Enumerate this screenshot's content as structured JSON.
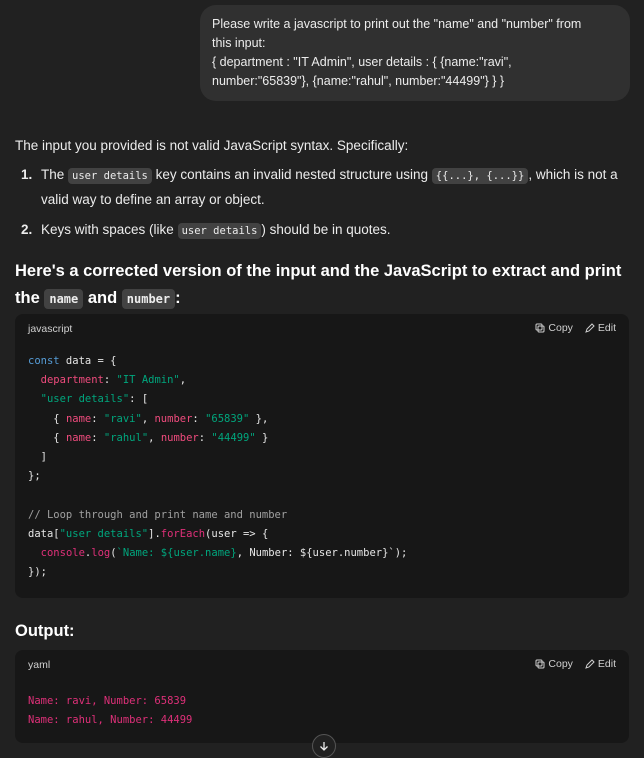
{
  "user_message": {
    "line1": "Please write a javascript to print out the \"name\" and \"number\" from",
    "line2": "this input:",
    "line3": "{ department : \"IT Admin\", user details : { {name:\"ravi\",",
    "line4": "number:\"65839\"}, {name:\"rahul\", number:\"44499\"} } }"
  },
  "response": {
    "intro": "The input you provided is not valid JavaScript syntax. Specifically:",
    "list": [
      {
        "num": "1.",
        "before": "The ",
        "code1": "user details",
        "middle": " key contains an invalid nested structure using ",
        "code2": "{{...}, {...}}",
        "after": ", which is not a valid way to define an array or object."
      },
      {
        "num": "2.",
        "before": "Keys with spaces (like ",
        "code1": "user details",
        "after": ") should be in quotes."
      }
    ],
    "heading": {
      "before": "Here's a corrected version of the input and the JavaScript to extract and print the ",
      "code1": "name",
      "middle": " and ",
      "code2": "number",
      "after": ":"
    },
    "code_block_1": {
      "lang": "javascript",
      "copy_label": "Copy",
      "edit_label": "Edit"
    },
    "output_heading": "Output:",
    "code_block_2": {
      "lang": "yaml",
      "copy_label": "Copy",
      "edit_label": "Edit",
      "line1": "Name: ravi, Number: 65839",
      "line2": "Name: rahul, Number: 44499"
    }
  },
  "colors": {
    "background": "#212121",
    "bubble": "#303030",
    "code_bg": "#171717",
    "keyword": "#569cd6",
    "property": "#ef4b7d",
    "string": "#00a67d"
  }
}
